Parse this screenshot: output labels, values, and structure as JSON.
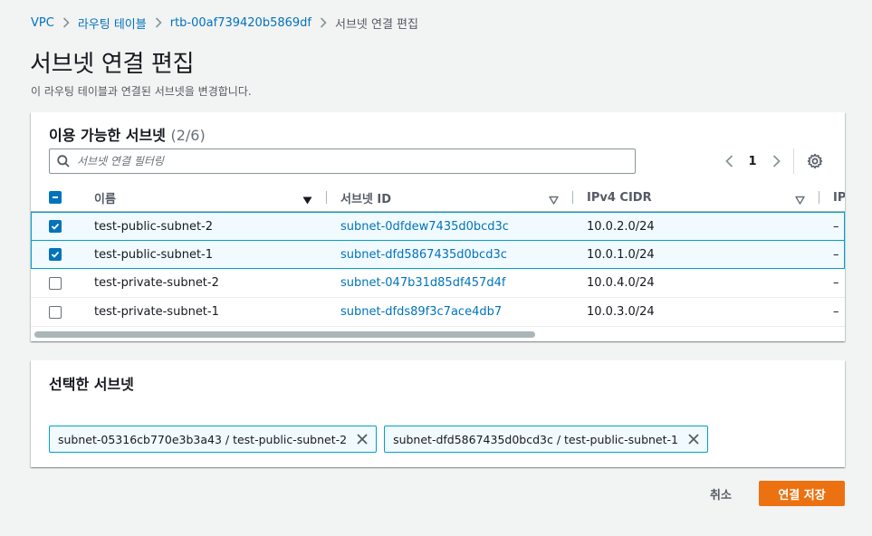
{
  "breadcrumb": [
    {
      "label": "VPC",
      "link": true
    },
    {
      "label": "라우팅 테이블",
      "link": true
    },
    {
      "label": "rtb-00af739420b5869df",
      "link": true
    },
    {
      "label": "서브넷 연결 편집",
      "link": false
    }
  ],
  "page": {
    "title": "서브넷 연결 편집",
    "description": "이 라우팅 테이블과 연결된 서브넷을 변경합니다."
  },
  "available": {
    "title": "이용 가능한 서브넷",
    "count": "(2/6)",
    "filter_placeholder": "서브넷 연결 필터링",
    "page_number": "1",
    "columns": [
      "이름",
      "서브넷 ID",
      "IPv4 CIDR",
      "IP"
    ],
    "rows": [
      {
        "name": "test-public-subnet-2",
        "subnet_id": "subnet-0dfdew7435d0bcd3c",
        "cidr": "10.0.2.0/24",
        "ip": "–",
        "checked": true
      },
      {
        "name": "test-public-subnet-1",
        "subnet_id": "subnet-dfd5867435d0bcd3c",
        "cidr": "10.0.1.0/24",
        "ip": "–",
        "checked": true
      },
      {
        "name": "test-private-subnet-2",
        "subnet_id": "subnet-047b31d85df457d4f",
        "cidr": "10.0.4.0/24",
        "ip": "–",
        "checked": false
      },
      {
        "name": "test-private-subnet-1",
        "subnet_id": "subnet-dfds89f3c7ace4db7",
        "cidr": "10.0.3.0/24",
        "ip": "–",
        "checked": false
      }
    ]
  },
  "selected": {
    "title": "선택한 서브넷",
    "tokens": [
      "subnet-05316cb770e3b3a43 / test-public-subnet-2",
      "subnet-dfd5867435d0bcd3c / test-public-subnet-1"
    ]
  },
  "actions": {
    "cancel_label": "취소",
    "save_label": "연결 저장"
  },
  "colors": {
    "link": "#0073bb",
    "primary_button": "#ec7211",
    "selected_row_border": "#00a1c9",
    "selected_row_bg": "#f1faff"
  }
}
